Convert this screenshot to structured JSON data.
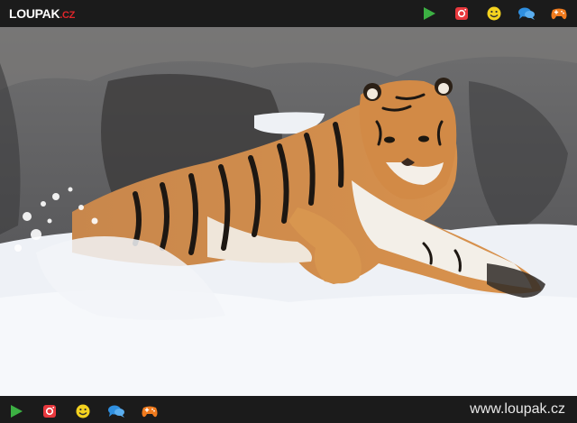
{
  "header": {
    "logo_main": "LOUPAK",
    "logo_suffix": ".CZ",
    "icons": [
      "play-icon",
      "instagram-icon",
      "smiley-icon",
      "chat-icon",
      "gamepad-icon"
    ]
  },
  "footer": {
    "icons": [
      "play-icon",
      "instagram-icon",
      "smiley-icon",
      "chat-icon",
      "gamepad-icon"
    ],
    "url": "www.loupak.cz"
  },
  "colors": {
    "bar_bg": "#1b1b1b",
    "brand_red": "#e0262a",
    "play_green": "#3cb043",
    "instagram_red": "#e8383d",
    "smiley_yellow": "#f4d21f",
    "chat_blue": "#2f8fe0",
    "gamepad_orange": "#f07b1e"
  }
}
